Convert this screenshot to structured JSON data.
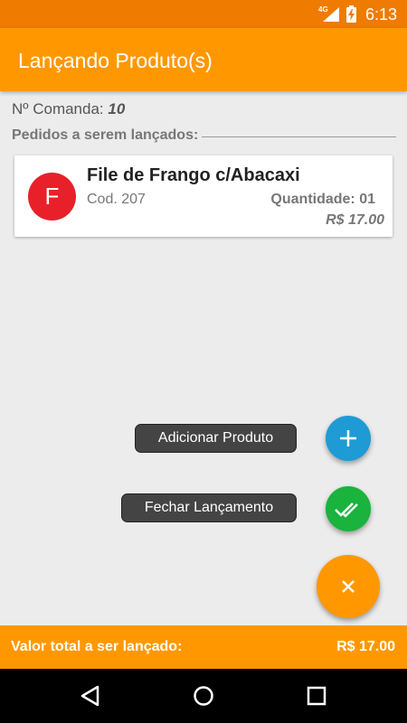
{
  "status_bar": {
    "network": "4G",
    "time": "6:13"
  },
  "app_bar": {
    "title": "Lançando Produto(s)"
  },
  "comanda": {
    "label": "Nº Comanda:",
    "number": "10"
  },
  "section": {
    "title": "Pedidos a serem lançados:"
  },
  "order_item": {
    "initial": "F",
    "name": "File de Frango c/Abacaxi",
    "code": "Cod. 207",
    "quantity": "Quantidade: 01",
    "price": "R$ 17.00",
    "avatar_color": "#e8202a"
  },
  "fab_menu": {
    "add_label": "Adicionar Produto",
    "close_label": "Fechar Lançamento",
    "add_icon": "plus-icon",
    "close_icon": "double-check-icon",
    "main_icon": "close-icon"
  },
  "total": {
    "label": "Valor total a ser lançado:",
    "value": "R$ 17.00"
  },
  "colors": {
    "primary": "#ff9800",
    "status_bar": "#ef7b00",
    "add": "#1e9bd5",
    "confirm": "#19b33d"
  }
}
